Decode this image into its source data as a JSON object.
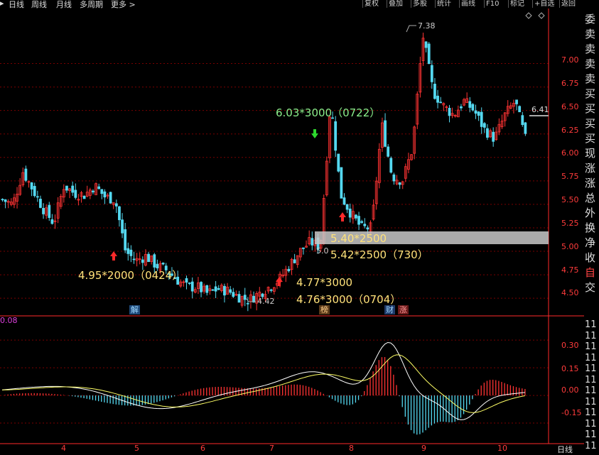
{
  "toolbar": {
    "left_tabs": [
      "日线",
      "周线",
      "月线",
      "多周期",
      "更多 >"
    ],
    "right_buttons": [
      "复权",
      "叠加",
      "多股",
      "统计",
      "画线",
      "F10",
      "标记",
      "+自选",
      "返回"
    ]
  },
  "right_panel_labels": [
    "委",
    "卖",
    "卖",
    "卖",
    "卖",
    "买",
    "买",
    "买",
    "买",
    "现",
    "涨",
    "涨",
    "总",
    "外",
    "换",
    "净",
    "收",
    "自",
    "交"
  ],
  "right_panel_bottom": [
    "11",
    "11",
    "11",
    "11",
    "11",
    "11",
    "11",
    "11",
    "11",
    "11",
    "11",
    "11"
  ],
  "price_axis": [
    "7.00",
    "6.75",
    "6.50",
    "6.25",
    "6.00",
    "5.75",
    "5.50",
    "5.25",
    "5.00",
    "4.75",
    "4.50"
  ],
  "macd_axis": [
    "0.30",
    "0.15",
    "0.00",
    "-0.15"
  ],
  "x_axis": [
    "4",
    "5",
    "6",
    "7",
    "8",
    "9",
    "10"
  ],
  "x_axis_right_label": "日线",
  "macd_label": "0.08",
  "price_high_label": "7.38",
  "price_low_label": "4.42",
  "current_price_label": "6.41",
  "price_marker_mid": "5.0",
  "annotations": {
    "buy_0424": "4.95*2000（0424）",
    "buy_477": "4.77*3000",
    "buy_0704": "4.76*3000（0704）",
    "sell_0722": "6.03*3000（0722）",
    "sell_540": "5.40*2500",
    "sell_730": "5.42*2500（730）"
  },
  "event_badges": [
    "解",
    "榜",
    "财",
    "涨"
  ],
  "colors": {
    "up": "#ff3333",
    "down": "#54d8f0",
    "grid": "#7a0000",
    "axis": "#ff2a2a"
  },
  "chart_data": {
    "type": "candlestick",
    "price_range": [
      4.35,
      7.45
    ],
    "macd_range": [
      -0.25,
      0.42
    ],
    "price_path": [
      [
        4.0,
        5.55
      ],
      [
        4.25,
        5.5
      ],
      [
        4.5,
        5.85
      ],
      [
        4.75,
        5.65
      ],
      [
        5.0,
        5.45
      ],
      [
        5.25,
        5.3
      ],
      [
        5.5,
        5.7
      ],
      [
        5.75,
        5.62
      ],
      [
        6.0,
        5.6
      ],
      [
        6.25,
        5.7
      ],
      [
        6.5,
        5.58
      ],
      [
        6.75,
        5.55
      ],
      [
        7.0,
        5.0
      ],
      [
        7.25,
        4.9
      ],
      [
        7.5,
        4.95
      ],
      [
        7.75,
        4.85
      ],
      [
        8.0,
        4.8
      ],
      [
        8.25,
        4.7
      ],
      [
        8.5,
        4.62
      ],
      [
        8.75,
        4.62
      ],
      [
        9.0,
        4.55
      ],
      [
        9.25,
        4.6
      ],
      [
        9.5,
        4.58
      ],
      [
        9.75,
        4.52
      ],
      [
        10.0,
        4.48
      ],
      [
        10.25,
        4.55
      ],
      [
        10.5,
        4.62
      ],
      [
        10.75,
        4.7
      ],
      [
        11.0,
        4.85
      ],
      [
        11.25,
        5.0
      ],
      [
        11.5,
        5.1
      ],
      [
        11.75,
        5.05
      ],
      [
        12.0,
        6.6
      ],
      [
        12.25,
        5.6
      ],
      [
        12.5,
        5.4
      ],
      [
        12.75,
        5.25
      ],
      [
        13.0,
        5.25
      ],
      [
        13.25,
        6.35
      ],
      [
        13.5,
        5.8
      ],
      [
        13.75,
        5.75
      ],
      [
        14.0,
        6.1
      ],
      [
        14.25,
        7.3
      ],
      [
        14.5,
        6.7
      ],
      [
        14.75,
        6.55
      ],
      [
        15.0,
        6.45
      ],
      [
        15.25,
        6.6
      ],
      [
        15.5,
        6.5
      ],
      [
        15.75,
        6.3
      ],
      [
        16.0,
        6.2
      ],
      [
        16.25,
        6.45
      ],
      [
        16.5,
        6.6
      ],
      [
        16.75,
        6.2
      ]
    ]
  }
}
